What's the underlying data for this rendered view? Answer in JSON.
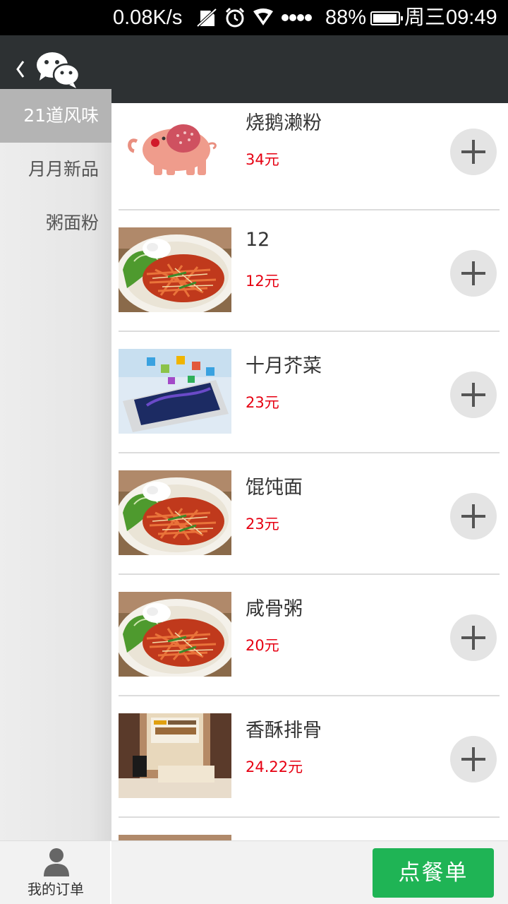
{
  "status_bar": {
    "net_speed": "0.08K/s",
    "battery_percent": "88%",
    "day": "周三",
    "time": "09:49",
    "icons": [
      "no-sim-icon",
      "alarm-icon",
      "wifi-icon",
      "signal-icon",
      "battery-icon"
    ]
  },
  "header": {
    "back_icon": "chevron-left-icon",
    "logo_icon": "wechat-logo-icon"
  },
  "sidebar": {
    "items": [
      {
        "label": "21道风味",
        "active": true
      },
      {
        "label": "月月新品",
        "active": false
      },
      {
        "label": "粥面粉",
        "active": false
      }
    ]
  },
  "dishes": [
    {
      "name": "烧鹅濑粉",
      "price": "34元",
      "image": "elephant"
    },
    {
      "name": "12",
      "price": "12元",
      "image": "noodles"
    },
    {
      "name": "十月芥菜",
      "price": "23元",
      "image": "phone"
    },
    {
      "name": "馄饨面",
      "price": "23元",
      "image": "noodles"
    },
    {
      "name": "咸骨粥",
      "price": "20元",
      "image": "noodles"
    },
    {
      "name": "香酥排骨",
      "price": "24.22元",
      "image": "room"
    },
    {
      "name": "",
      "price": "",
      "image": "noodles"
    }
  ],
  "bottom_bar": {
    "my_orders_label": "我的订单",
    "order_list_label": "点餐单"
  },
  "colors": {
    "header_bg": "#2d3133",
    "price": "#e60012",
    "order_button": "#1fb455",
    "sidebar_active": "#b4b4b4"
  }
}
